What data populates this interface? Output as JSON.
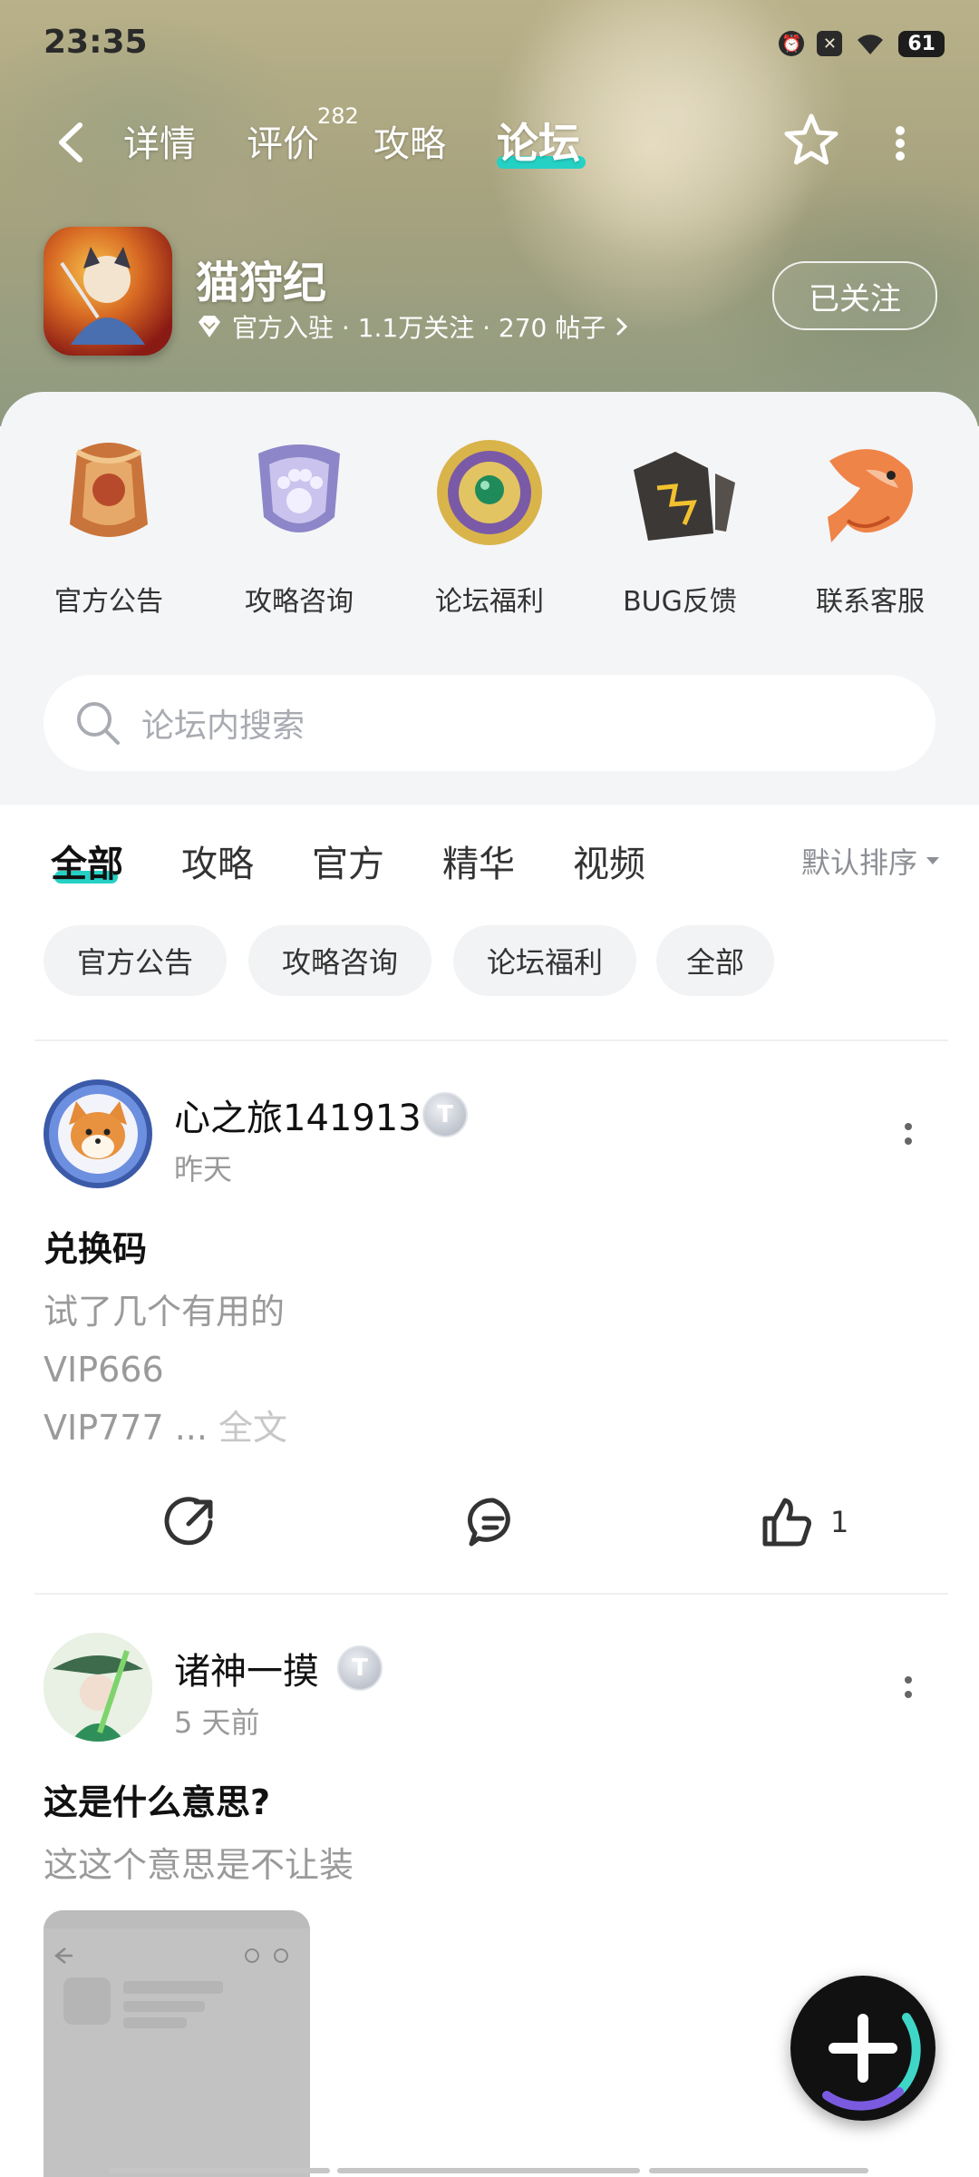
{
  "status_bar": {
    "time": "23:35",
    "battery": "61",
    "icons": [
      "alarm-icon",
      "dnd-icon",
      "wifi-icon"
    ]
  },
  "nav": {
    "tabs": [
      {
        "label": "详情"
      },
      {
        "label": "评价",
        "badge": "282"
      },
      {
        "label": "攻略"
      },
      {
        "label": "论坛",
        "active": true
      }
    ]
  },
  "app": {
    "title": "猫狩纪",
    "meta": "官方入驻 · 1.1万关注 · 270 帖子",
    "follow_label": "已关注"
  },
  "categories": [
    {
      "label": "官方公告",
      "icon": "notice-scroll-icon"
    },
    {
      "label": "攻略咨询",
      "icon": "paw-shield-icon"
    },
    {
      "label": "论坛福利",
      "icon": "gem-medallion-icon"
    },
    {
      "label": "BUG反馈",
      "icon": "broken-stone-icon"
    },
    {
      "label": "联系客服",
      "icon": "koi-fish-icon"
    }
  ],
  "search": {
    "placeholder": "论坛内搜索"
  },
  "feed_tabs": [
    {
      "label": "全部",
      "active": true
    },
    {
      "label": "攻略"
    },
    {
      "label": "官方"
    },
    {
      "label": "精华"
    },
    {
      "label": "视频"
    }
  ],
  "sort_label": "默认排序",
  "chips": [
    "官方公告",
    "攻略咨询",
    "论坛福利",
    "全部"
  ],
  "posts": [
    {
      "username": "心之旅141913",
      "time": "昨天",
      "title": "兑换码",
      "lines": [
        "试了几个有用的",
        "VIP666",
        "VIP777 ..."
      ],
      "more_label": " 全文",
      "like_count": "1"
    },
    {
      "username": "诸神一摸",
      "time": "5 天前",
      "title": "这是什么意思?",
      "lines": [
        "这这个意思是不让装"
      ]
    }
  ],
  "colors": {
    "accent": "#25d1c4",
    "panel_bg": "#f4f5f7",
    "muted_text": "#9a9a9a"
  }
}
